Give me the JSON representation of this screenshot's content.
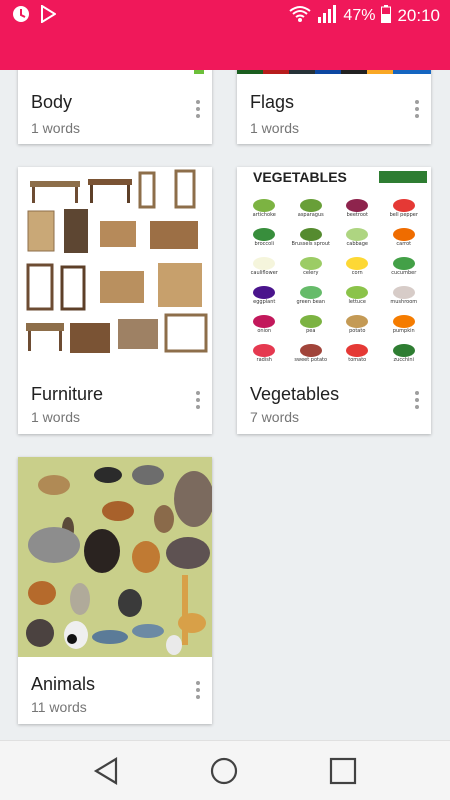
{
  "colors": {
    "status_bar": "#f0185a",
    "card_bg": "#ffffff",
    "page_bg": "#eceff1"
  },
  "status_bar": {
    "left_icons": [
      "app-notification-icon",
      "play-store-icon"
    ],
    "wifi_icon": "wifi-icon",
    "signal_icon": "signal-icon",
    "battery_percent": "47%",
    "battery_icon": "battery-icon",
    "time": "20:10"
  },
  "cards": [
    {
      "title": "Body",
      "subtitle": "1 words",
      "image": "body-thumbnail"
    },
    {
      "title": "Flags",
      "subtitle": "1 words",
      "image": "flags-thumbnail"
    },
    {
      "title": "Furniture",
      "subtitle": "1 words",
      "image": "furniture-thumbnail"
    },
    {
      "title": "Vegetables",
      "subtitle": "7 words",
      "image": "vegetables-thumbnail",
      "image_text": {
        "heading": "VEGETABLES",
        "items": [
          "artichoke",
          "asparagus",
          "beetroot",
          "bell pepper",
          "broccoli",
          "Brussels sprout",
          "cabbage",
          "carrot",
          "cauliflower",
          "celery",
          "corn",
          "cucumber",
          "eggplant",
          "green bean",
          "lettuce",
          "mushroom",
          "onion",
          "pea",
          "potato",
          "pumpkin",
          "radish",
          "sweet potato",
          "tomato",
          "zucchini"
        ]
      }
    },
    {
      "title": "Animals",
      "subtitle": "11 words",
      "image": "animals-thumbnail"
    }
  ],
  "nav_bar": {
    "back": "back-icon",
    "home": "home-icon",
    "recents": "recents-icon"
  }
}
